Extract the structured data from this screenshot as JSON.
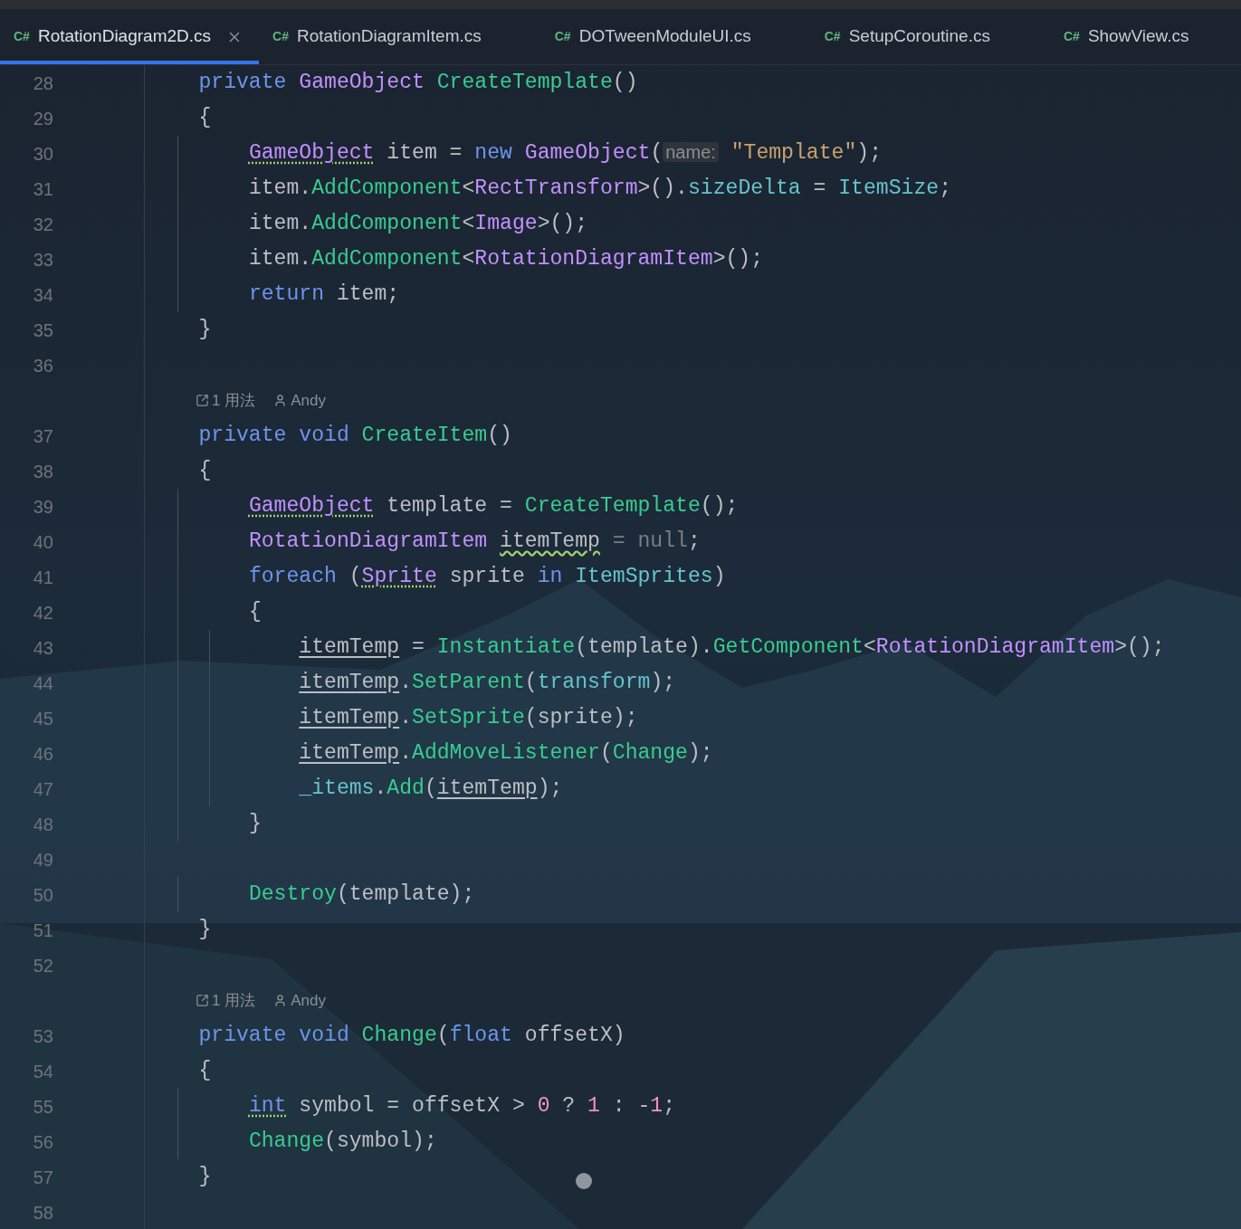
{
  "tabs": [
    {
      "icon_text": "C#",
      "label": "RotationDiagram2D.cs",
      "selected": true
    },
    {
      "icon_text": "C#",
      "label": "RotationDiagramItem.cs",
      "selected": false
    },
    {
      "icon_text": "C#",
      "label": "DOTweenModuleUI.cs",
      "selected": false
    },
    {
      "icon_text": "C#",
      "label": "SetupCoroutine.cs",
      "selected": false
    },
    {
      "icon_text": "C#",
      "label": "ShowView.cs",
      "selected": false
    }
  ],
  "lines": [
    {
      "kind": "code",
      "number": "28",
      "tokens": [
        {
          "kind": "keyword",
          "text": "    private "
        },
        {
          "kind": "type",
          "text": "GameObject "
        },
        {
          "kind": "method",
          "text": "CreateTemplate"
        },
        {
          "kind": "plain",
          "text": "()"
        }
      ]
    },
    {
      "kind": "code",
      "number": "29",
      "tokens": [
        {
          "kind": "plain",
          "text": "    {"
        }
      ]
    },
    {
      "kind": "code",
      "number": "30",
      "tokens": [
        {
          "kind": "type",
          "text": "        GameObject",
          "dotted_underline": true
        },
        {
          "kind": "plain",
          "text": " item = "
        },
        {
          "kind": "keyword",
          "text": "new "
        },
        {
          "kind": "type",
          "text": "GameObject"
        },
        {
          "kind": "plain",
          "text": "("
        },
        {
          "kind": "hint",
          "text": "name:"
        },
        {
          "kind": "string",
          "text": " \"Template\""
        },
        {
          "kind": "plain",
          "text": ");"
        }
      ]
    },
    {
      "kind": "code",
      "number": "31",
      "tokens": [
        {
          "kind": "plain",
          "text": "        item."
        },
        {
          "kind": "method",
          "text": "AddComponent"
        },
        {
          "kind": "plain",
          "text": "<"
        },
        {
          "kind": "type",
          "text": "RectTransform"
        },
        {
          "kind": "plain",
          "text": ">()."
        },
        {
          "kind": "field",
          "text": "sizeDelta"
        },
        {
          "kind": "plain",
          "text": " = "
        },
        {
          "kind": "field",
          "text": "ItemSize"
        },
        {
          "kind": "plain",
          "text": ";"
        }
      ]
    },
    {
      "kind": "code",
      "number": "32",
      "tokens": [
        {
          "kind": "plain",
          "text": "        item."
        },
        {
          "kind": "method",
          "text": "AddComponent"
        },
        {
          "kind": "plain",
          "text": "<"
        },
        {
          "kind": "type",
          "text": "Image"
        },
        {
          "kind": "plain",
          "text": ">();"
        }
      ]
    },
    {
      "kind": "code",
      "number": "33",
      "tokens": [
        {
          "kind": "plain",
          "text": "        item."
        },
        {
          "kind": "method",
          "text": "AddComponent"
        },
        {
          "kind": "plain",
          "text": "<"
        },
        {
          "kind": "type",
          "text": "RotationDiagramItem"
        },
        {
          "kind": "plain",
          "text": ">();"
        }
      ]
    },
    {
      "kind": "code",
      "number": "34",
      "tokens": [
        {
          "kind": "keyword",
          "text": "        return"
        },
        {
          "kind": "plain",
          "text": " item;"
        }
      ]
    },
    {
      "kind": "code",
      "number": "35",
      "tokens": [
        {
          "kind": "plain",
          "text": "    }"
        }
      ]
    },
    {
      "kind": "code",
      "number": "36"
    },
    {
      "kind": "lens",
      "usages": "1 用法",
      "author": "Andy"
    },
    {
      "kind": "code",
      "number": "37",
      "tokens": [
        {
          "kind": "keyword",
          "text": "    private void "
        },
        {
          "kind": "method",
          "text": "CreateItem"
        },
        {
          "kind": "plain",
          "text": "()"
        }
      ]
    },
    {
      "kind": "code",
      "number": "38",
      "tokens": [
        {
          "kind": "plain",
          "text": "    {"
        }
      ]
    },
    {
      "kind": "code",
      "number": "39",
      "tokens": [
        {
          "kind": "type",
          "text": "        GameObject",
          "dotted_underline": true
        },
        {
          "kind": "plain",
          "text": " template = "
        },
        {
          "kind": "method",
          "text": "CreateTemplate"
        },
        {
          "kind": "plain",
          "text": "();"
        }
      ]
    },
    {
      "kind": "code",
      "number": "40",
      "tokens": [
        {
          "kind": "type",
          "text": "        RotationDiagramItem "
        },
        {
          "kind": "plain",
          "text": "itemTemp",
          "wavy_underline": true
        },
        {
          "kind": "dim",
          "text": " = null"
        },
        {
          "kind": "plain",
          "text": ";"
        }
      ]
    },
    {
      "kind": "code",
      "number": "41",
      "tokens": [
        {
          "kind": "keyword",
          "text": "        foreach "
        },
        {
          "kind": "plain",
          "text": "("
        },
        {
          "kind": "type",
          "text": "Sprite",
          "dotted_underline": true
        },
        {
          "kind": "plain",
          "text": " sprite "
        },
        {
          "kind": "keyword",
          "text": "in "
        },
        {
          "kind": "field",
          "text": "ItemSprites"
        },
        {
          "kind": "plain",
          "text": ")"
        }
      ]
    },
    {
      "kind": "code",
      "number": "42",
      "tokens": [
        {
          "kind": "plain",
          "text": "        {"
        }
      ]
    },
    {
      "kind": "code",
      "number": "43",
      "tokens": [
        {
          "kind": "plain",
          "text": "            itemTemp",
          "underlined": true
        },
        {
          "kind": "plain",
          "text": " = "
        },
        {
          "kind": "method",
          "text": "Instantiate"
        },
        {
          "kind": "plain",
          "text": "(template)."
        },
        {
          "kind": "method",
          "text": "GetComponent"
        },
        {
          "kind": "plain",
          "text": "<"
        },
        {
          "kind": "type",
          "text": "RotationDiagramItem"
        },
        {
          "kind": "plain",
          "text": ">();"
        }
      ]
    },
    {
      "kind": "code",
      "number": "44",
      "tokens": [
        {
          "kind": "plain",
          "text": "            itemTemp.",
          "underlined": true
        },
        {
          "kind": "method",
          "text": "SetParent"
        },
        {
          "kind": "plain",
          "text": "("
        },
        {
          "kind": "field",
          "text": "transform"
        },
        {
          "kind": "plain",
          "text": ");"
        }
      ]
    },
    {
      "kind": "code",
      "number": "45",
      "tokens": [
        {
          "kind": "plain",
          "text": "            itemTemp.",
          "underlined": true
        },
        {
          "kind": "method",
          "text": "SetSprite"
        },
        {
          "kind": "plain",
          "text": "(sprite);"
        }
      ]
    },
    {
      "kind": "code",
      "number": "46",
      "tokens": [
        {
          "kind": "plain",
          "text": "            itemTemp.",
          "underlined": true
        },
        {
          "kind": "method",
          "text": "AddMoveListener"
        },
        {
          "kind": "plain",
          "text": "("
        },
        {
          "kind": "method",
          "text": "Change"
        },
        {
          "kind": "plain",
          "text": ");"
        }
      ]
    },
    {
      "kind": "code",
      "number": "47",
      "tokens": [
        {
          "kind": "field",
          "text": "            _items"
        },
        {
          "kind": "plain",
          "text": "."
        },
        {
          "kind": "method",
          "text": "Add"
        },
        {
          "kind": "plain",
          "text": "("
        },
        {
          "kind": "plain",
          "text": "itemTemp",
          "underlined": true
        },
        {
          "kind": "plain",
          "text": ");"
        }
      ]
    },
    {
      "kind": "code",
      "number": "48",
      "tokens": [
        {
          "kind": "plain",
          "text": "        }"
        }
      ]
    },
    {
      "kind": "code",
      "number": "49"
    },
    {
      "kind": "code",
      "number": "50",
      "tokens": [
        {
          "kind": "method",
          "text": "        Destroy"
        },
        {
          "kind": "plain",
          "text": "(template);"
        }
      ]
    },
    {
      "kind": "code",
      "number": "51",
      "tokens": [
        {
          "kind": "plain",
          "text": "    }"
        }
      ]
    },
    {
      "kind": "code",
      "number": "52"
    },
    {
      "kind": "lens",
      "usages": "1 用法",
      "author": "Andy"
    },
    {
      "kind": "code",
      "number": "53",
      "tokens": [
        {
          "kind": "keyword",
          "text": "    private void "
        },
        {
          "kind": "method",
          "text": "Change"
        },
        {
          "kind": "plain",
          "text": "("
        },
        {
          "kind": "keyword",
          "text": "float"
        },
        {
          "kind": "plain",
          "text": " offsetX)"
        }
      ]
    },
    {
      "kind": "code",
      "number": "54",
      "tokens": [
        {
          "kind": "plain",
          "text": "    {"
        }
      ]
    },
    {
      "kind": "code",
      "number": "55",
      "tokens": [
        {
          "kind": "keyword",
          "text": "        int",
          "dotted_underline": true
        },
        {
          "kind": "plain",
          "text": " symbol = offsetX > "
        },
        {
          "kind": "number",
          "text": "0"
        },
        {
          "kind": "plain",
          "text": " ? "
        },
        {
          "kind": "number",
          "text": "1"
        },
        {
          "kind": "plain",
          "text": " : -"
        },
        {
          "kind": "number",
          "text": "1"
        },
        {
          "kind": "plain",
          "text": ";"
        }
      ]
    },
    {
      "kind": "code",
      "number": "56",
      "tokens": [
        {
          "kind": "method",
          "text": "        Change"
        },
        {
          "kind": "plain",
          "text": "(symbol);"
        }
      ]
    },
    {
      "kind": "code",
      "number": "57",
      "tokens": [
        {
          "kind": "plain",
          "text": "    }"
        }
      ]
    },
    {
      "kind": "code",
      "number": "58"
    }
  ]
}
